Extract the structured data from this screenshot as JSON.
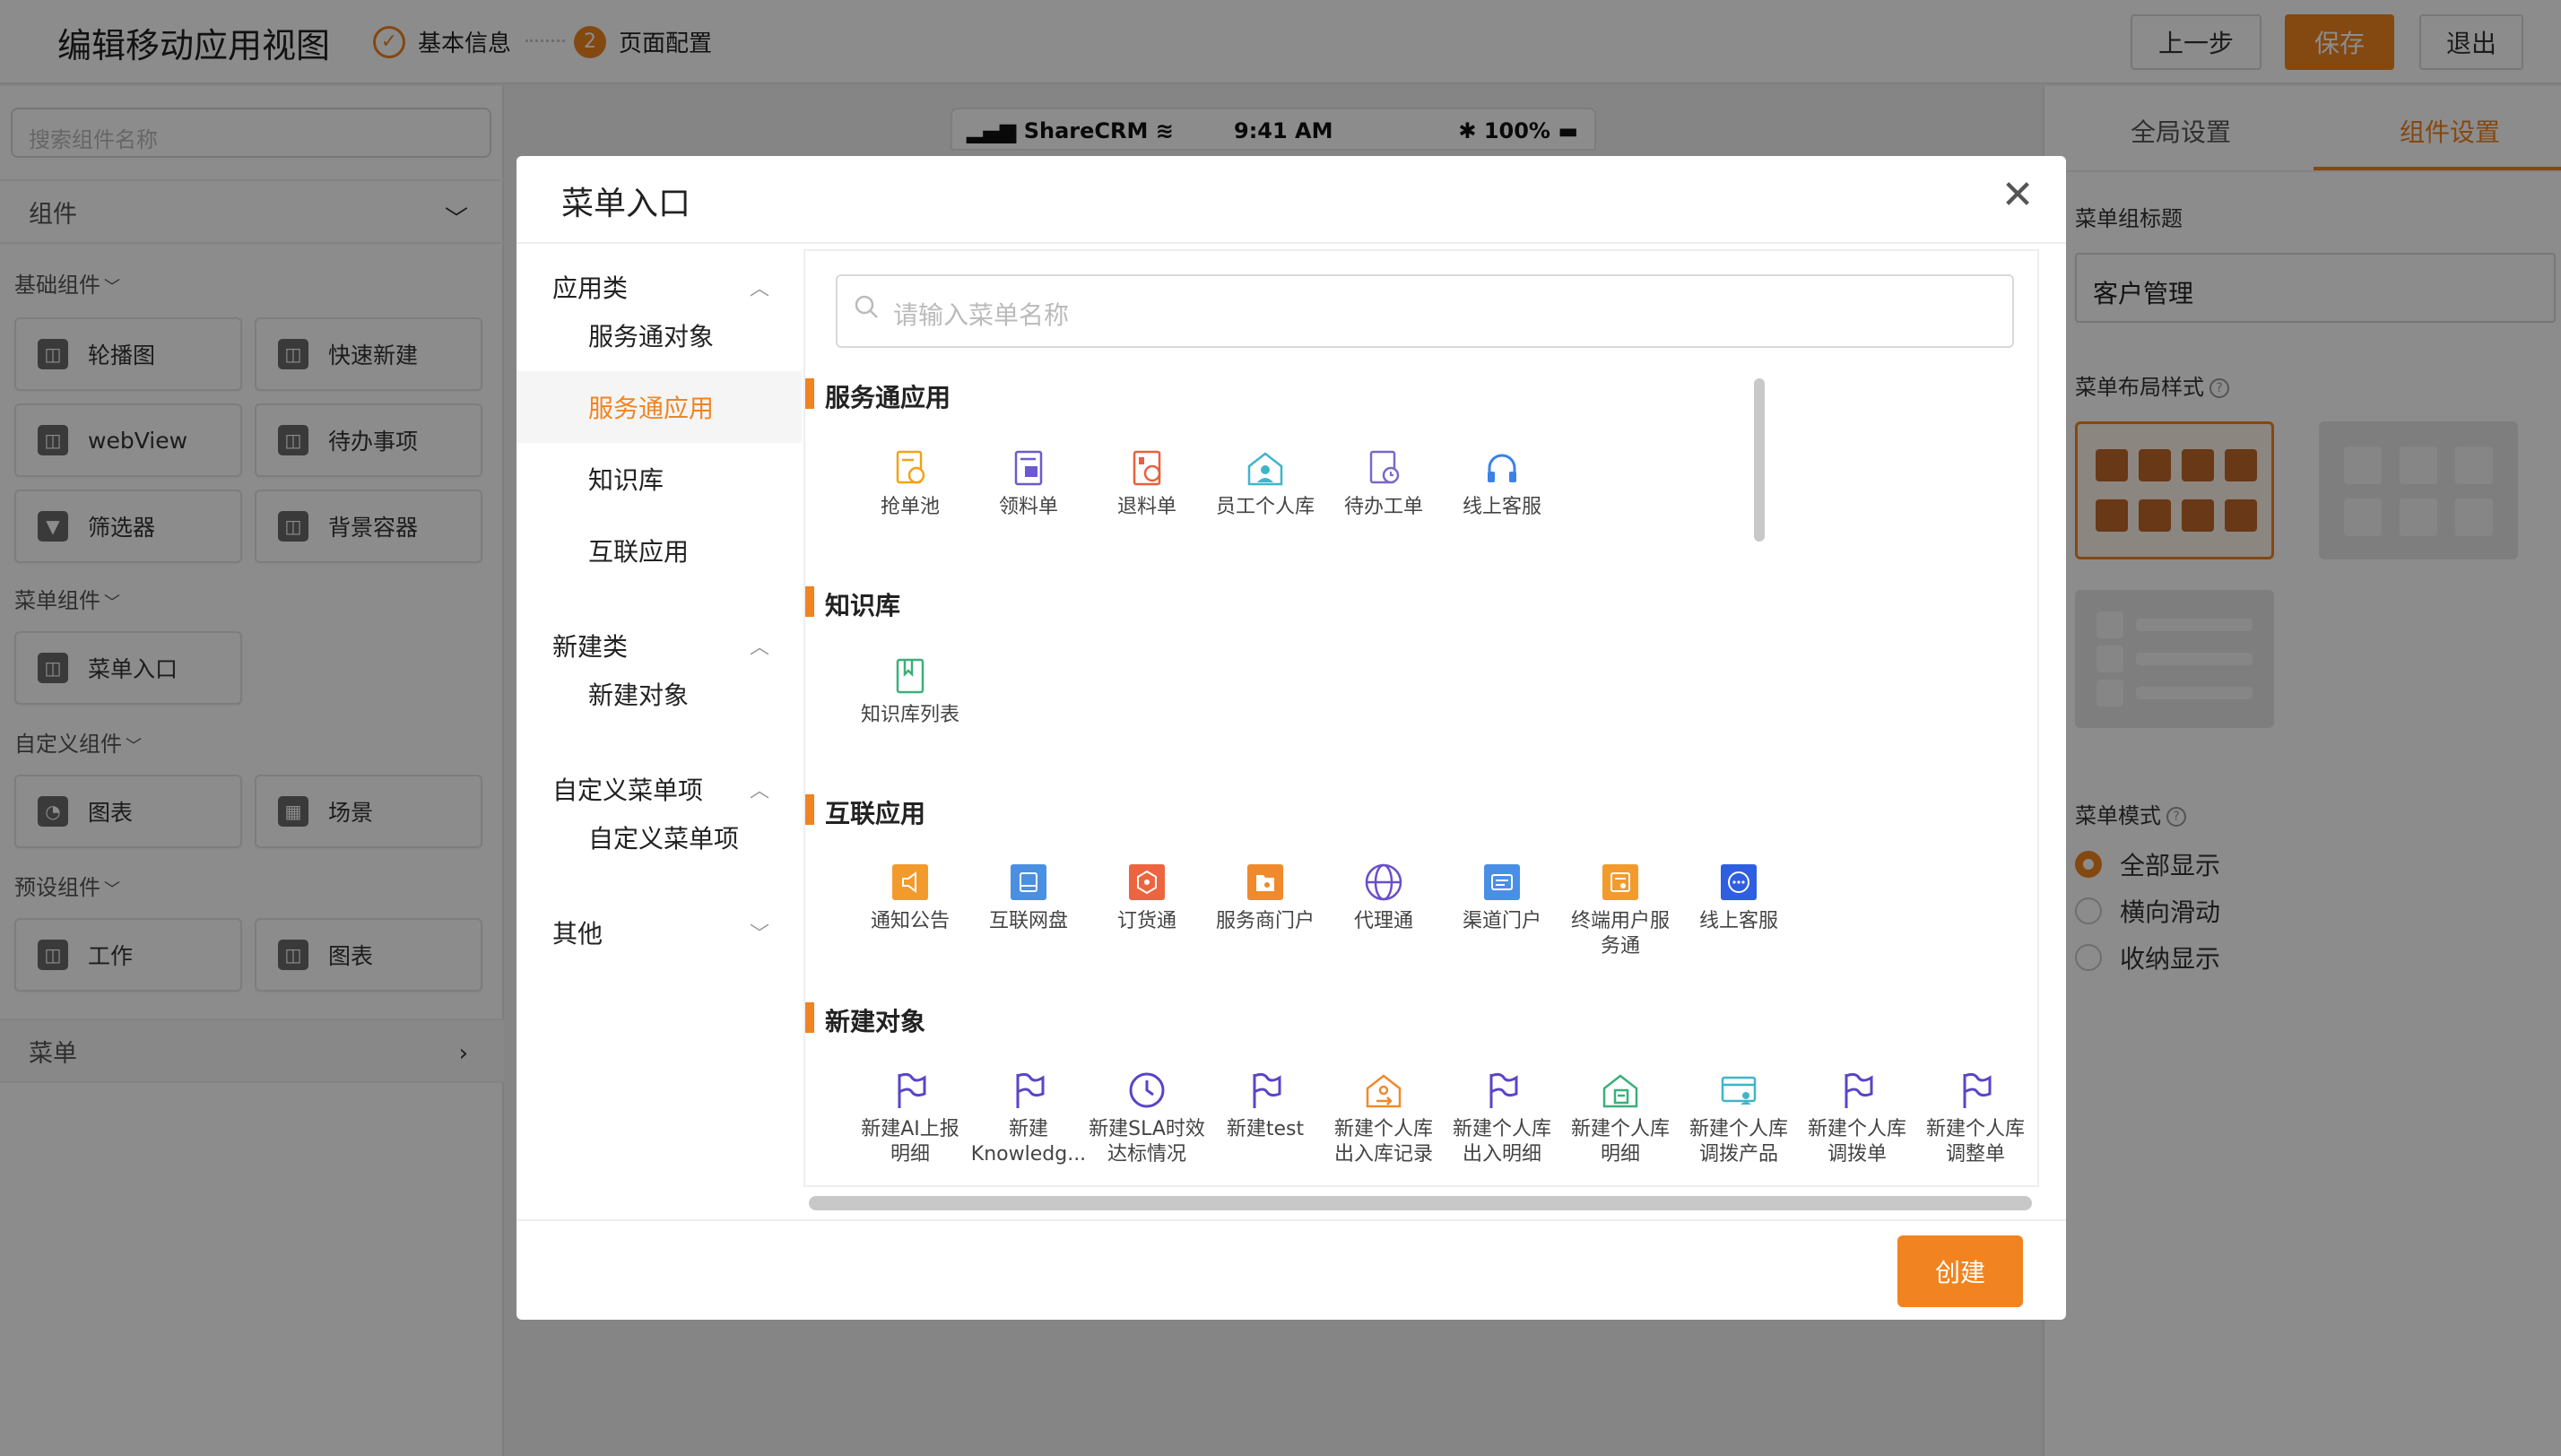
{
  "header": {
    "title": "编辑移动应用视图",
    "steps": [
      {
        "index": "✓",
        "label": "基本信息"
      },
      {
        "index": "2",
        "label": "页面配置"
      }
    ],
    "buttons": {
      "prev": "上一步",
      "save": "保存",
      "exit": "退出"
    }
  },
  "left_panel": {
    "search_placeholder": "搜索组件名称",
    "section_components": "组件",
    "section_menu": "菜单",
    "groups": [
      {
        "title": "基础组件",
        "items": [
          "轮播图",
          "快速新建",
          "webView",
          "待办事项",
          "筛选器",
          "背景容器"
        ]
      },
      {
        "title": "菜单组件",
        "items": [
          "菜单入口"
        ]
      },
      {
        "title": "自定义组件",
        "items": [
          "图表",
          "场景"
        ]
      },
      {
        "title": "预设组件",
        "items": [
          "工作",
          "图表"
        ]
      }
    ]
  },
  "phone": {
    "carrier": "ShareCRM",
    "time": "9:41 AM",
    "battery": "100%"
  },
  "right_panel": {
    "tabs": [
      "全局设置",
      "组件设置"
    ],
    "menu_group_title_label": "菜单组标题",
    "menu_group_title_value": "客户管理",
    "layout_style_label": "菜单布局样式",
    "menu_mode_label": "菜单模式",
    "menu_modes": [
      "全部显示",
      "横向滑动",
      "收纳显示"
    ],
    "menu_mode_selected": "全部显示"
  },
  "modal": {
    "title": "菜单入口",
    "search_placeholder": "请输入菜单名称",
    "create_label": "创建",
    "nav": [
      {
        "group": "应用类",
        "items": [
          "服务通对象",
          "服务通应用",
          "知识库",
          "互联应用"
        ]
      },
      {
        "group": "新建类",
        "items": [
          "新建对象"
        ]
      },
      {
        "group": "自定义菜单项",
        "items": [
          "自定义菜单项"
        ]
      },
      {
        "group": "其他",
        "items": []
      }
    ],
    "active_nav": "服务通应用",
    "sections": [
      {
        "title": "服务通应用",
        "tiles": [
          "抢单池",
          "领料单",
          "退料单",
          "员工个人库",
          "待办工单",
          "线上客服"
        ]
      },
      {
        "title": "知识库",
        "tiles": [
          "知识库列表"
        ]
      },
      {
        "title": "互联应用",
        "tiles": [
          "通知公告",
          "互联网盘",
          "订货通",
          "服务商门户",
          "代理通",
          "渠道门户",
          "终端用户服务通",
          "线上客服"
        ]
      },
      {
        "title": "新建对象",
        "tiles": [
          "新建AI上报明细",
          "新建Knowledg...",
          "新建SLA时效达标情况",
          "新建test",
          "新建个人库出入库记录",
          "新建个人库出入明细",
          "新建个人库明细",
          "新建个人库调拨产品",
          "新建个人库调拨单",
          "新建个人库调整单"
        ]
      }
    ]
  },
  "colors": {
    "accent": "#f18420",
    "overlay": "rgba(0,0,0,0.45)"
  }
}
